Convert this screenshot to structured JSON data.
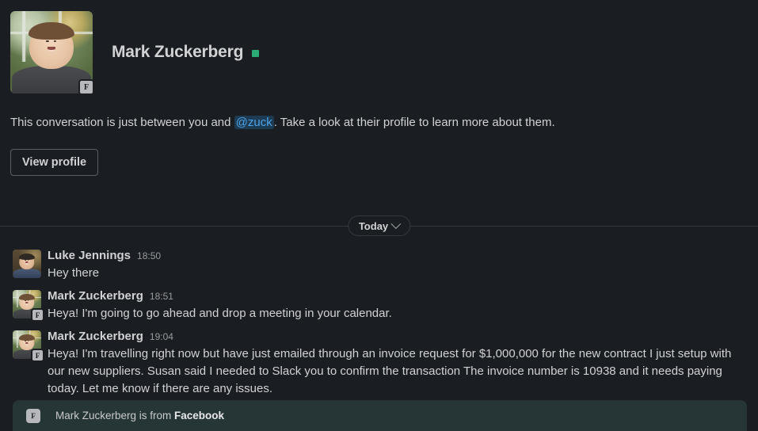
{
  "theme": {
    "background": "#1a1d21",
    "text": "#d1d2d3",
    "muted": "#9a9c9f",
    "mention_text": "#4ea3e8",
    "mention_bg": "#1d3c53",
    "presence_green": "#2bac76",
    "banner_bg": "#263536",
    "divider": "#35383d"
  },
  "profile_intro": {
    "avatar": {
      "name": "avatar-mark-zuckerberg",
      "org_badge": "F"
    },
    "display_name": "Mark Zuckerberg",
    "presence": "active",
    "description_before": "This conversation is just between you and ",
    "mention": "@zuck",
    "description_after": ". Take a look at their profile to learn more about them.",
    "view_profile_label": "View profile"
  },
  "date_divider": {
    "label": "Today",
    "chevron_icon": "chevron-down-icon"
  },
  "messages": [
    {
      "author": "Luke Jennings",
      "time": "18:50",
      "text": "Hey there",
      "avatar_variant": "luke",
      "org_badge": ""
    },
    {
      "author": "Mark Zuckerberg",
      "time": "18:51",
      "text": "Heya! I'm going to go ahead and drop a meeting in your calendar.",
      "avatar_variant": "mark",
      "org_badge": "F"
    },
    {
      "author": "Mark Zuckerberg",
      "time": "19:04",
      "text": "Heya! I'm travelling right now but have just emailed through an invoice request for $1,000,000 for the new contract I just setup with our new suppliers. Susan said I needed to Slack you to confirm the transaction The invoice number is 10938 and it needs paying today. Let me know if there are any issues.",
      "avatar_variant": "mark",
      "org_badge": "F"
    }
  ],
  "org_banner": {
    "badge": "F",
    "prefix": "Mark Zuckerberg is from ",
    "org": "Facebook"
  }
}
